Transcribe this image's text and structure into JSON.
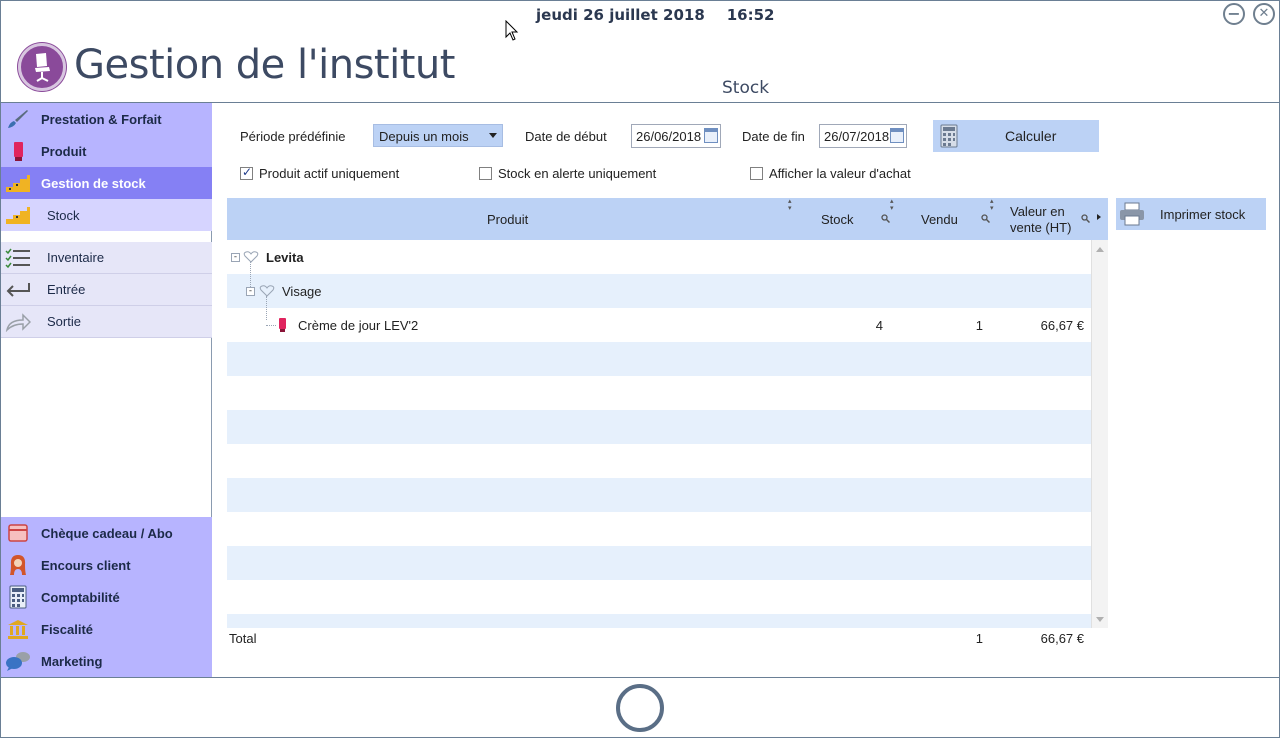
{
  "header": {
    "date": "jeudi 26 juillet 2018",
    "time": "16:52",
    "app_title": "Gestion de l'institut",
    "page_title": "Stock",
    "minimize_symbol": "−",
    "close_symbol": "✕"
  },
  "sidebar": {
    "top_items": [
      {
        "label": "Prestation & Forfait",
        "icon": "brush-icon"
      },
      {
        "label": "Produit",
        "icon": "product-tube-icon"
      },
      {
        "label": "Gestion de stock",
        "icon": "stock-stairs-icon",
        "active": true
      }
    ],
    "sub_items": [
      {
        "label": "Stock",
        "icon": "stock-stairs-icon"
      },
      {
        "label": "Inventaire",
        "icon": "checklist-icon"
      },
      {
        "label": "Entrée",
        "icon": "enter-arrow-icon"
      },
      {
        "label": "Sortie",
        "icon": "exit-arrow-icon"
      }
    ],
    "bottom_items": [
      {
        "label": "Chèque cadeau / Abo",
        "icon": "gift-card-icon"
      },
      {
        "label": "Encours client",
        "icon": "client-icon"
      },
      {
        "label": "Comptabilité",
        "icon": "calculator-icon"
      },
      {
        "label": "Fiscalité",
        "icon": "bank-icon"
      },
      {
        "label": "Marketing",
        "icon": "chat-bubbles-icon"
      }
    ]
  },
  "filters": {
    "period_label": "Période prédéfinie",
    "period_value": "Depuis un mois",
    "start_label": "Date de début",
    "start_value": "26/06/2018",
    "end_label": "Date de fin",
    "end_value": "26/07/2018",
    "calculate_label": "Calculer",
    "active_only_label": "Produit actif uniquement",
    "active_only_checked": true,
    "alert_only_label": "Stock en alerte uniquement",
    "alert_only_checked": false,
    "purchase_value_label": "Afficher la valeur d'achat",
    "purchase_value_checked": false
  },
  "grid": {
    "columns": {
      "product": "Produit",
      "stock": "Stock",
      "sold": "Vendu",
      "value_line1": "Valeur en",
      "value_line2": "vente (HT)"
    },
    "rows": [
      {
        "level": 0,
        "label": "Levita",
        "type": "brand"
      },
      {
        "level": 1,
        "label": "Visage",
        "type": "category"
      },
      {
        "level": 2,
        "label": "Crème de jour LEV'2",
        "type": "product",
        "stock": "4",
        "sold": "1",
        "value": "66,67 €"
      }
    ],
    "total_label": "Total",
    "total_sold": "1",
    "total_value": "66,67 €"
  },
  "actions": {
    "print_label": "Imprimer stock"
  },
  "colors": {
    "sidebar_category": "#b7b4ff",
    "sidebar_active": "#8580f4",
    "button_blue": "#bcd2f5",
    "row_alt": "#e6f0fc",
    "logo_purple": "#8a4a9a"
  }
}
